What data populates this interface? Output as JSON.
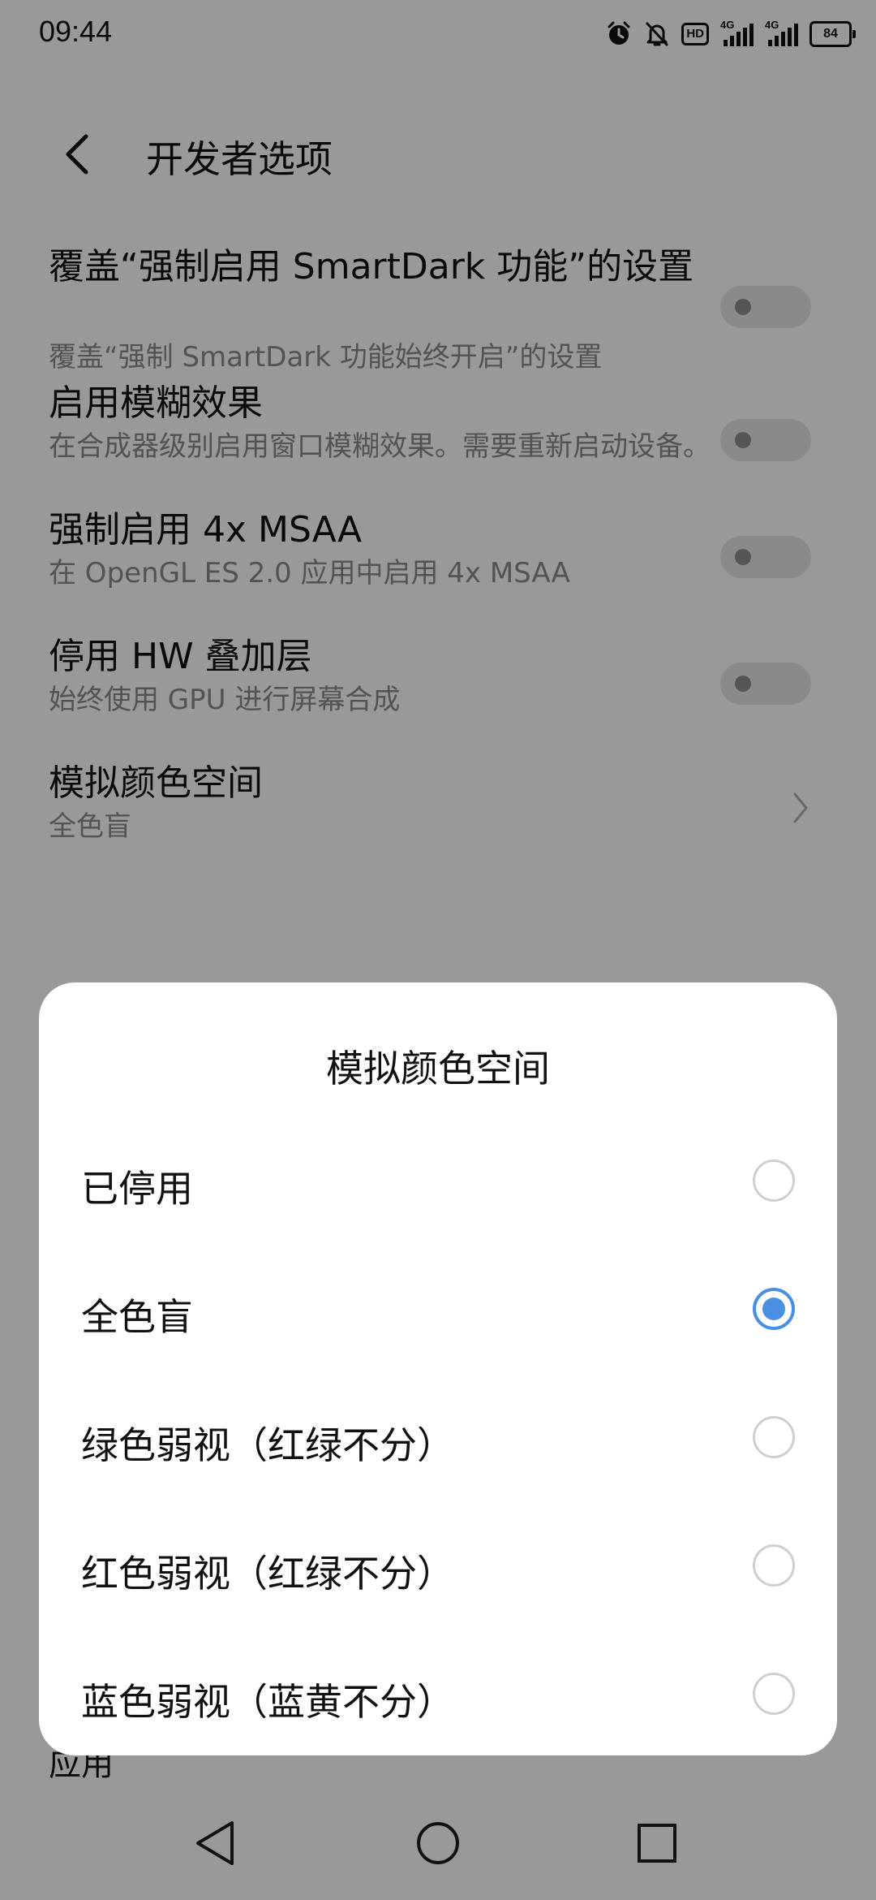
{
  "status_bar": {
    "time": "09:44",
    "icons": [
      "alarm-icon",
      "mute-bell-icon",
      "hd-icon",
      "signal-4g-icon",
      "signal-4g-icon",
      "battery-icon"
    ],
    "hd_label": "HD",
    "net1": "4G",
    "net2": "4G",
    "battery": "84"
  },
  "header": {
    "title": "开发者选项",
    "back_icon": "chevron-left-icon"
  },
  "settings": [
    {
      "title": "覆盖“强制启用 SmartDark 功能”的设置",
      "subtitle": "覆盖“强制 SmartDark 功能始终开启”的设置",
      "control": "toggle-off"
    },
    {
      "title": "启用模糊效果",
      "subtitle": "在合成器级别启用窗口模糊效果。需要重新启动设备。",
      "control": "toggle-off"
    },
    {
      "title": "强制启用 4x MSAA",
      "subtitle": "在 OpenGL ES 2.0 应用中启用 4x MSAA",
      "control": "toggle-off"
    },
    {
      "title": "停用 HW 叠加层",
      "subtitle": "始终使用 GPU 进行屏幕合成",
      "control": "toggle-off"
    },
    {
      "title": "模拟颜色空间",
      "subtitle": "全色盲",
      "control": "chevron"
    }
  ],
  "behind_dialog_text": "应用",
  "dialog": {
    "title": "模拟颜色空间",
    "options": [
      {
        "label": "已停用",
        "selected": false
      },
      {
        "label": "全色盲",
        "selected": true
      },
      {
        "label": "绿色弱视（红绿不分）",
        "selected": false
      },
      {
        "label": "红色弱视（红绿不分）",
        "selected": false
      },
      {
        "label": "蓝色弱视（蓝黄不分）",
        "selected": false
      }
    ]
  },
  "colors": {
    "accent": "#4a90e2",
    "scrim": "rgba(0,0,0,0.40)"
  },
  "navbar": {
    "icons": [
      "back-triangle-icon",
      "home-circle-icon",
      "recents-square-icon"
    ]
  }
}
